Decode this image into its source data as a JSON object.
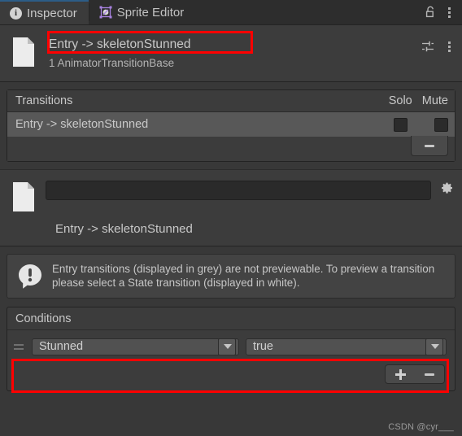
{
  "window": {
    "tabs": [
      {
        "label": "Inspector",
        "icon": "info-icon",
        "active": true
      },
      {
        "label": "Sprite Editor",
        "icon": "sprite-editor-icon",
        "active": false
      }
    ],
    "lock_icon": "unlocked-padlock-icon",
    "menu_icon": "kebab-menu-icon"
  },
  "object_header": {
    "icon": "document-page-icon",
    "title": "Entry -> skeletonStunned",
    "subtitle": "1 AnimatorTransitionBase",
    "preset_icon": "preset-sliders-icon",
    "menu_icon": "kebab-menu-icon"
  },
  "transitions": {
    "title": "Transitions",
    "col_solo": "Solo",
    "col_mute": "Mute",
    "rows": [
      {
        "label": "Entry -> skeletonStunned",
        "solo": false,
        "mute": false
      }
    ],
    "remove_button": "-"
  },
  "preview": {
    "name_value": "",
    "name_placeholder": "",
    "gear_icon": "gear-icon",
    "doc_icon": "document-page-icon",
    "transition_name": "Entry -> skeletonStunned"
  },
  "helpbox": {
    "icon": "info-bubble-icon",
    "message": "Entry transitions (displayed in grey) are not previewable. To preview a transition please select a State transition (displayed in white)."
  },
  "conditions": {
    "title": "Conditions",
    "rows": [
      {
        "parameter": "Stunned",
        "value": "true"
      }
    ],
    "add_button": "+",
    "remove_button": "-"
  },
  "watermark": "CSDN @cyr___",
  "colors": {
    "accent_tab": "#2c5d87",
    "annotation": "#ff0000",
    "panel_bg": "#3c3c3c",
    "window_bg": "#383838",
    "row_selected": "#585858"
  }
}
